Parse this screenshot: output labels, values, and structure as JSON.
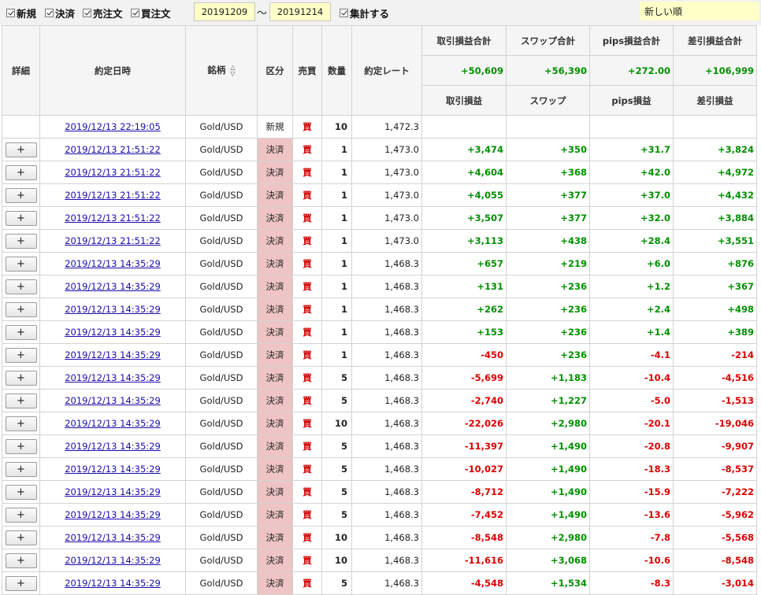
{
  "toolbar": {
    "filters": [
      {
        "label": "新規",
        "checked": true
      },
      {
        "label": "決済",
        "checked": true
      },
      {
        "label": "売注文",
        "checked": true
      },
      {
        "label": "買注文",
        "checked": true
      }
    ],
    "date_from": "20191209",
    "date_separator": "〜",
    "date_to": "20191214",
    "aggregate_label": "集計する",
    "sort_order": "新しい順"
  },
  "headers": {
    "detail": "詳細",
    "datetime": "約定日時",
    "symbol": "銘柄",
    "kubun": "区分",
    "side": "売買",
    "qty": "数量",
    "rate": "約定レート",
    "pl_total": "取引損益合計",
    "swap_total": "スワップ合計",
    "pips_total": "pips損益合計",
    "net_total": "差引損益合計",
    "pl": "取引損益",
    "swap": "スワップ",
    "pips": "pips損益",
    "net": "差引損益"
  },
  "totals": {
    "pl": "+50,609",
    "swap": "+56,390",
    "pips": "+272.00",
    "net": "+106,999"
  },
  "detail_button_label": "+",
  "rows": [
    {
      "detail": false,
      "datetime": "2019/12/13 22:19:05",
      "symbol": "Gold/USD",
      "kubun": "新規",
      "side": "買",
      "qty": "10",
      "rate": "1,472.3",
      "pl": "",
      "swap": "",
      "pips": "",
      "net": ""
    },
    {
      "detail": true,
      "datetime": "2019/12/13 21:51:22",
      "symbol": "Gold/USD",
      "kubun": "決済",
      "side": "買",
      "qty": "1",
      "rate": "1,473.0",
      "pl": "+3,474",
      "swap": "+350",
      "pips": "+31.7",
      "net": "+3,824"
    },
    {
      "detail": true,
      "datetime": "2019/12/13 21:51:22",
      "symbol": "Gold/USD",
      "kubun": "決済",
      "side": "買",
      "qty": "1",
      "rate": "1,473.0",
      "pl": "+4,604",
      "swap": "+368",
      "pips": "+42.0",
      "net": "+4,972"
    },
    {
      "detail": true,
      "datetime": "2019/12/13 21:51:22",
      "symbol": "Gold/USD",
      "kubun": "決済",
      "side": "買",
      "qty": "1",
      "rate": "1,473.0",
      "pl": "+4,055",
      "swap": "+377",
      "pips": "+37.0",
      "net": "+4,432"
    },
    {
      "detail": true,
      "datetime": "2019/12/13 21:51:22",
      "symbol": "Gold/USD",
      "kubun": "決済",
      "side": "買",
      "qty": "1",
      "rate": "1,473.0",
      "pl": "+3,507",
      "swap": "+377",
      "pips": "+32.0",
      "net": "+3,884"
    },
    {
      "detail": true,
      "datetime": "2019/12/13 21:51:22",
      "symbol": "Gold/USD",
      "kubun": "決済",
      "side": "買",
      "qty": "1",
      "rate": "1,473.0",
      "pl": "+3,113",
      "swap": "+438",
      "pips": "+28.4",
      "net": "+3,551"
    },
    {
      "detail": true,
      "datetime": "2019/12/13 14:35:29",
      "symbol": "Gold/USD",
      "kubun": "決済",
      "side": "買",
      "qty": "1",
      "rate": "1,468.3",
      "pl": "+657",
      "swap": "+219",
      "pips": "+6.0",
      "net": "+876"
    },
    {
      "detail": true,
      "datetime": "2019/12/13 14:35:29",
      "symbol": "Gold/USD",
      "kubun": "決済",
      "side": "買",
      "qty": "1",
      "rate": "1,468.3",
      "pl": "+131",
      "swap": "+236",
      "pips": "+1.2",
      "net": "+367"
    },
    {
      "detail": true,
      "datetime": "2019/12/13 14:35:29",
      "symbol": "Gold/USD",
      "kubun": "決済",
      "side": "買",
      "qty": "1",
      "rate": "1,468.3",
      "pl": "+262",
      "swap": "+236",
      "pips": "+2.4",
      "net": "+498"
    },
    {
      "detail": true,
      "datetime": "2019/12/13 14:35:29",
      "symbol": "Gold/USD",
      "kubun": "決済",
      "side": "買",
      "qty": "1",
      "rate": "1,468.3",
      "pl": "+153",
      "swap": "+236",
      "pips": "+1.4",
      "net": "+389"
    },
    {
      "detail": true,
      "datetime": "2019/12/13 14:35:29",
      "symbol": "Gold/USD",
      "kubun": "決済",
      "side": "買",
      "qty": "1",
      "rate": "1,468.3",
      "pl": "-450",
      "swap": "+236",
      "pips": "-4.1",
      "net": "-214"
    },
    {
      "detail": true,
      "datetime": "2019/12/13 14:35:29",
      "symbol": "Gold/USD",
      "kubun": "決済",
      "side": "買",
      "qty": "5",
      "rate": "1,468.3",
      "pl": "-5,699",
      "swap": "+1,183",
      "pips": "-10.4",
      "net": "-4,516"
    },
    {
      "detail": true,
      "datetime": "2019/12/13 14:35:29",
      "symbol": "Gold/USD",
      "kubun": "決済",
      "side": "買",
      "qty": "5",
      "rate": "1,468.3",
      "pl": "-2,740",
      "swap": "+1,227",
      "pips": "-5.0",
      "net": "-1,513"
    },
    {
      "detail": true,
      "datetime": "2019/12/13 14:35:29",
      "symbol": "Gold/USD",
      "kubun": "決済",
      "side": "買",
      "qty": "10",
      "rate": "1,468.3",
      "pl": "-22,026",
      "swap": "+2,980",
      "pips": "-20.1",
      "net": "-19,046"
    },
    {
      "detail": true,
      "datetime": "2019/12/13 14:35:29",
      "symbol": "Gold/USD",
      "kubun": "決済",
      "side": "買",
      "qty": "5",
      "rate": "1,468.3",
      "pl": "-11,397",
      "swap": "+1,490",
      "pips": "-20.8",
      "net": "-9,907"
    },
    {
      "detail": true,
      "datetime": "2019/12/13 14:35:29",
      "symbol": "Gold/USD",
      "kubun": "決済",
      "side": "買",
      "qty": "5",
      "rate": "1,468.3",
      "pl": "-10,027",
      "swap": "+1,490",
      "pips": "-18.3",
      "net": "-8,537"
    },
    {
      "detail": true,
      "datetime": "2019/12/13 14:35:29",
      "symbol": "Gold/USD",
      "kubun": "決済",
      "side": "買",
      "qty": "5",
      "rate": "1,468.3",
      "pl": "-8,712",
      "swap": "+1,490",
      "pips": "-15.9",
      "net": "-7,222"
    },
    {
      "detail": true,
      "datetime": "2019/12/13 14:35:29",
      "symbol": "Gold/USD",
      "kubun": "決済",
      "side": "買",
      "qty": "5",
      "rate": "1,468.3",
      "pl": "-7,452",
      "swap": "+1,490",
      "pips": "-13.6",
      "net": "-5,962"
    },
    {
      "detail": true,
      "datetime": "2019/12/13 14:35:29",
      "symbol": "Gold/USD",
      "kubun": "決済",
      "side": "買",
      "qty": "10",
      "rate": "1,468.3",
      "pl": "-8,548",
      "swap": "+2,980",
      "pips": "-7.8",
      "net": "-5,568"
    },
    {
      "detail": true,
      "datetime": "2019/12/13 14:35:29",
      "symbol": "Gold/USD",
      "kubun": "決済",
      "side": "買",
      "qty": "10",
      "rate": "1,468.3",
      "pl": "-11,616",
      "swap": "+3,068",
      "pips": "-10.6",
      "net": "-8,548"
    },
    {
      "detail": true,
      "datetime": "2019/12/13 14:35:29",
      "symbol": "Gold/USD",
      "kubun": "決済",
      "side": "買",
      "qty": "5",
      "rate": "1,468.3",
      "pl": "-4,548",
      "swap": "+1,534",
      "pips": "-8.3",
      "net": "-3,014"
    }
  ],
  "colors": {
    "positive": "#009000",
    "negative": "#dd0000",
    "settle_bg": "#efc4c4",
    "input_bg": "#ffffc8",
    "side": "#d00000"
  }
}
